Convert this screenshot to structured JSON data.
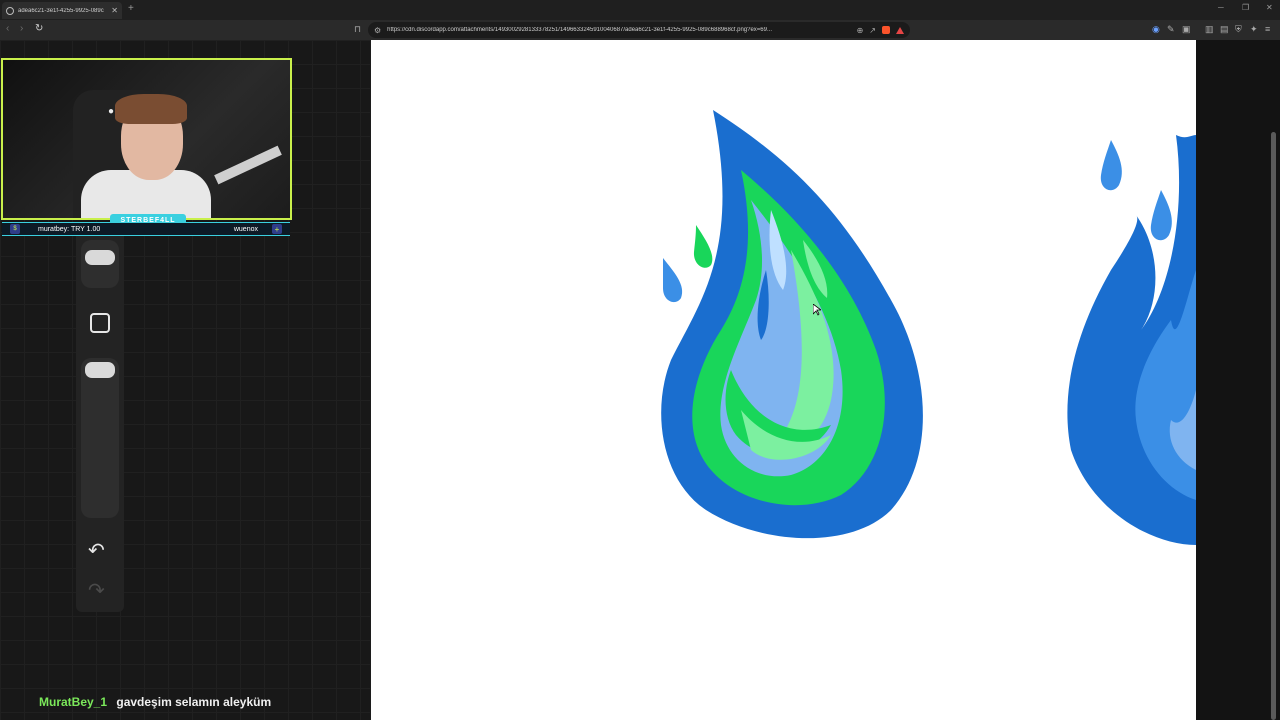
{
  "browser": {
    "tab_title": "adea6c21-3e1f-4255-9925-089c",
    "tab_close_icon": "close-icon",
    "new_tab_icon": "plus-icon",
    "url": "https://cdn.discordapp.com/attachments/1493002928133378251/1496633245910040687/adea6c21-3e1f-4255-9925-089c688968cf.png?ex=69...",
    "window_controls": [
      "minimize-icon",
      "restore-icon",
      "close-icon"
    ]
  },
  "stream": {
    "nameplate": "STERBEF4LL",
    "donation_text": "muratbey: TRY 1.00",
    "username": "wuenox",
    "dollar_badge": "$",
    "plus_badge": "+"
  },
  "chat": {
    "username": "MuratBey_1",
    "message": "gavdeşim selamın aleyküm"
  },
  "colors": {
    "flame_dark_blue": "#1a6ecf",
    "flame_mid_blue": "#3b8fe6",
    "flame_light_blue": "#7fb4f0",
    "flame_green": "#19d65a",
    "flame_light_green": "#7cf0a0",
    "webcam_border": "#c9f04b",
    "overlay_cyan": "#3ad0e0",
    "chat_username": "#7be85a"
  }
}
